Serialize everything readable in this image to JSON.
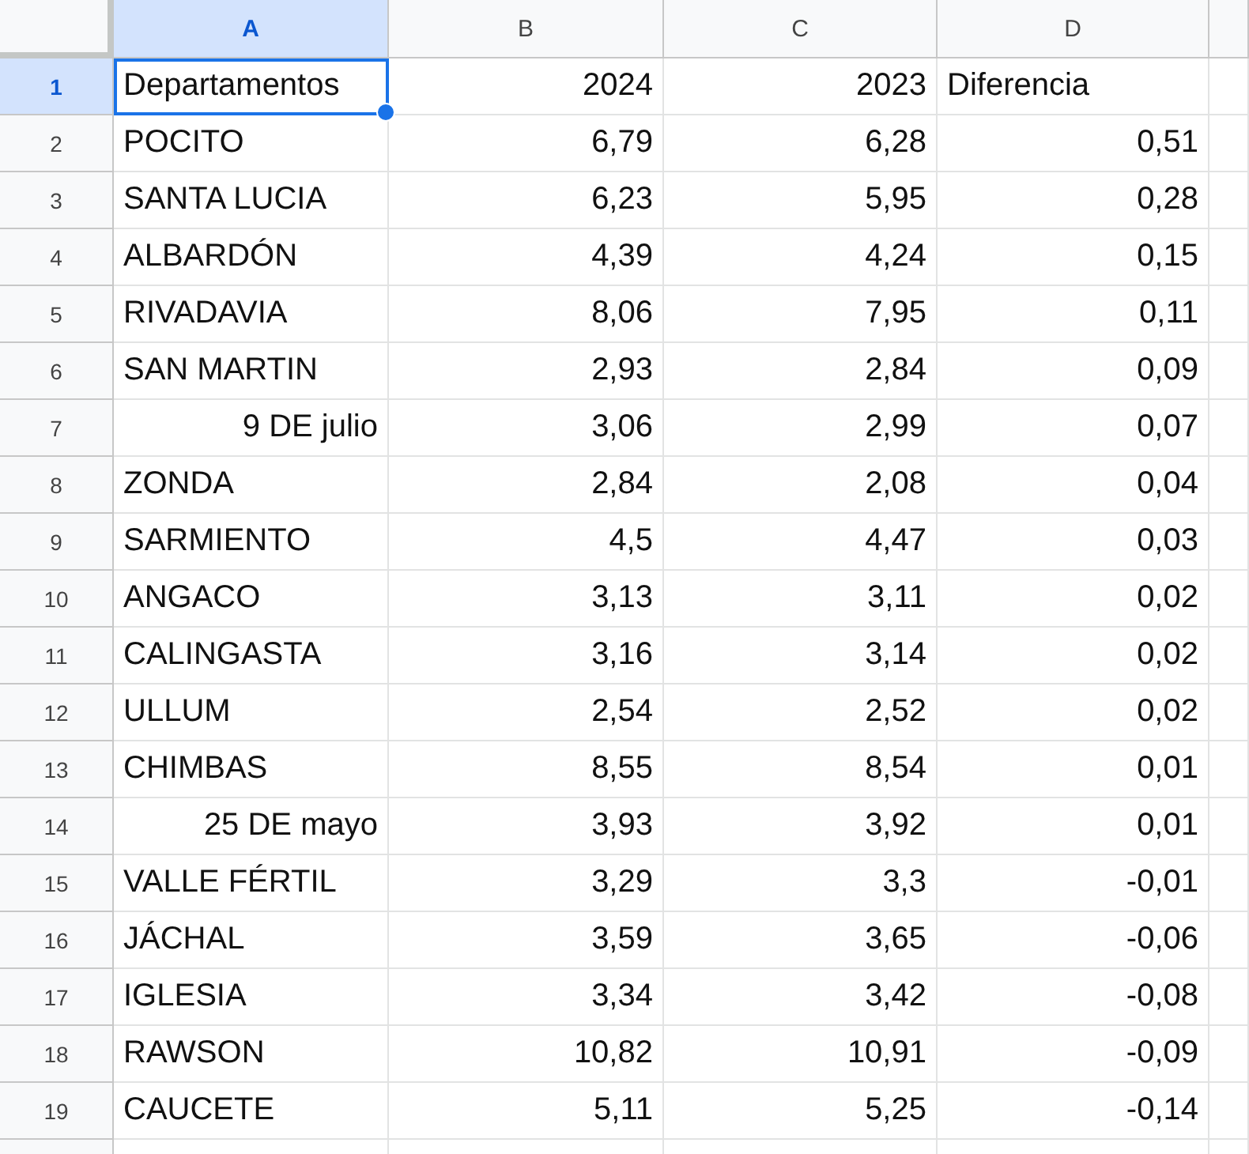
{
  "columns": [
    {
      "label": "A",
      "selected": true
    },
    {
      "label": "B",
      "selected": false
    },
    {
      "label": "C",
      "selected": false
    },
    {
      "label": "D",
      "selected": false
    }
  ],
  "rows": [
    {
      "number": "1",
      "selected": true,
      "cells": [
        {
          "text": "Departamentos",
          "right_aligned": false,
          "selected": true
        },
        {
          "text": "2024",
          "right_aligned": true,
          "selected": false
        },
        {
          "text": "2023",
          "right_aligned": true,
          "selected": false
        },
        {
          "text": "Diferencia",
          "right_aligned": false,
          "selected": false
        }
      ]
    },
    {
      "number": "2",
      "selected": false,
      "cells": [
        {
          "text": "POCITO",
          "right_aligned": false,
          "selected": false
        },
        {
          "text": "6,79",
          "right_aligned": true,
          "selected": false
        },
        {
          "text": "6,28",
          "right_aligned": true,
          "selected": false
        },
        {
          "text": "0,51",
          "right_aligned": true,
          "selected": false
        }
      ]
    },
    {
      "number": "3",
      "selected": false,
      "cells": [
        {
          "text": "SANTA LUCIA",
          "right_aligned": false,
          "selected": false
        },
        {
          "text": "6,23",
          "right_aligned": true,
          "selected": false
        },
        {
          "text": "5,95",
          "right_aligned": true,
          "selected": false
        },
        {
          "text": "0,28",
          "right_aligned": true,
          "selected": false
        }
      ]
    },
    {
      "number": "4",
      "selected": false,
      "cells": [
        {
          "text": "ALBARDÓN",
          "right_aligned": false,
          "selected": false
        },
        {
          "text": "4,39",
          "right_aligned": true,
          "selected": false
        },
        {
          "text": "4,24",
          "right_aligned": true,
          "selected": false
        },
        {
          "text": "0,15",
          "right_aligned": true,
          "selected": false
        }
      ]
    },
    {
      "number": "5",
      "selected": false,
      "cells": [
        {
          "text": "RIVADAVIA",
          "right_aligned": false,
          "selected": false
        },
        {
          "text": "8,06",
          "right_aligned": true,
          "selected": false
        },
        {
          "text": "7,95",
          "right_aligned": true,
          "selected": false
        },
        {
          "text": "0,11",
          "right_aligned": true,
          "selected": false
        }
      ]
    },
    {
      "number": "6",
      "selected": false,
      "cells": [
        {
          "text": "SAN MARTIN",
          "right_aligned": false,
          "selected": false
        },
        {
          "text": "2,93",
          "right_aligned": true,
          "selected": false
        },
        {
          "text": "2,84",
          "right_aligned": true,
          "selected": false
        },
        {
          "text": "0,09",
          "right_aligned": true,
          "selected": false
        }
      ]
    },
    {
      "number": "7",
      "selected": false,
      "cells": [
        {
          "text": "9 DE julio",
          "right_aligned": true,
          "selected": false
        },
        {
          "text": "3,06",
          "right_aligned": true,
          "selected": false
        },
        {
          "text": "2,99",
          "right_aligned": true,
          "selected": false
        },
        {
          "text": "0,07",
          "right_aligned": true,
          "selected": false
        }
      ]
    },
    {
      "number": "8",
      "selected": false,
      "cells": [
        {
          "text": "ZONDA",
          "right_aligned": false,
          "selected": false
        },
        {
          "text": "2,84",
          "right_aligned": true,
          "selected": false
        },
        {
          "text": "2,08",
          "right_aligned": true,
          "selected": false
        },
        {
          "text": "0,04",
          "right_aligned": true,
          "selected": false
        }
      ]
    },
    {
      "number": "9",
      "selected": false,
      "cells": [
        {
          "text": "SARMIENTO",
          "right_aligned": false,
          "selected": false
        },
        {
          "text": "4,5",
          "right_aligned": true,
          "selected": false
        },
        {
          "text": "4,47",
          "right_aligned": true,
          "selected": false
        },
        {
          "text": "0,03",
          "right_aligned": true,
          "selected": false
        }
      ]
    },
    {
      "number": "10",
      "selected": false,
      "cells": [
        {
          "text": "ANGACO",
          "right_aligned": false,
          "selected": false
        },
        {
          "text": "3,13",
          "right_aligned": true,
          "selected": false
        },
        {
          "text": "3,11",
          "right_aligned": true,
          "selected": false
        },
        {
          "text": "0,02",
          "right_aligned": true,
          "selected": false
        }
      ]
    },
    {
      "number": "11",
      "selected": false,
      "cells": [
        {
          "text": "CALINGASTA",
          "right_aligned": false,
          "selected": false
        },
        {
          "text": "3,16",
          "right_aligned": true,
          "selected": false
        },
        {
          "text": "3,14",
          "right_aligned": true,
          "selected": false
        },
        {
          "text": "0,02",
          "right_aligned": true,
          "selected": false
        }
      ]
    },
    {
      "number": "12",
      "selected": false,
      "cells": [
        {
          "text": "ULLUM",
          "right_aligned": false,
          "selected": false
        },
        {
          "text": "2,54",
          "right_aligned": true,
          "selected": false
        },
        {
          "text": "2,52",
          "right_aligned": true,
          "selected": false
        },
        {
          "text": "0,02",
          "right_aligned": true,
          "selected": false
        }
      ]
    },
    {
      "number": "13",
      "selected": false,
      "cells": [
        {
          "text": "CHIMBAS",
          "right_aligned": false,
          "selected": false
        },
        {
          "text": "8,55",
          "right_aligned": true,
          "selected": false
        },
        {
          "text": "8,54",
          "right_aligned": true,
          "selected": false
        },
        {
          "text": "0,01",
          "right_aligned": true,
          "selected": false
        }
      ]
    },
    {
      "number": "14",
      "selected": false,
      "cells": [
        {
          "text": "25 DE mayo",
          "right_aligned": true,
          "selected": false
        },
        {
          "text": "3,93",
          "right_aligned": true,
          "selected": false
        },
        {
          "text": "3,92",
          "right_aligned": true,
          "selected": false
        },
        {
          "text": "0,01",
          "right_aligned": true,
          "selected": false
        }
      ]
    },
    {
      "number": "15",
      "selected": false,
      "cells": [
        {
          "text": "VALLE FÉRTIL",
          "right_aligned": false,
          "selected": false
        },
        {
          "text": "3,29",
          "right_aligned": true,
          "selected": false
        },
        {
          "text": "3,3",
          "right_aligned": true,
          "selected": false
        },
        {
          "text": "-0,01",
          "right_aligned": true,
          "selected": false
        }
      ]
    },
    {
      "number": "16",
      "selected": false,
      "cells": [
        {
          "text": "JÁCHAL",
          "right_aligned": false,
          "selected": false
        },
        {
          "text": "3,59",
          "right_aligned": true,
          "selected": false
        },
        {
          "text": "3,65",
          "right_aligned": true,
          "selected": false
        },
        {
          "text": "-0,06",
          "right_aligned": true,
          "selected": false
        }
      ]
    },
    {
      "number": "17",
      "selected": false,
      "cells": [
        {
          "text": "IGLESIA",
          "right_aligned": false,
          "selected": false
        },
        {
          "text": "3,34",
          "right_aligned": true,
          "selected": false
        },
        {
          "text": "3,42",
          "right_aligned": true,
          "selected": false
        },
        {
          "text": "-0,08",
          "right_aligned": true,
          "selected": false
        }
      ]
    },
    {
      "number": "18",
      "selected": false,
      "cells": [
        {
          "text": "RAWSON",
          "right_aligned": false,
          "selected": false
        },
        {
          "text": "10,82",
          "right_aligned": true,
          "selected": false
        },
        {
          "text": "10,91",
          "right_aligned": true,
          "selected": false
        },
        {
          "text": "-0,09",
          "right_aligned": true,
          "selected": false
        }
      ]
    },
    {
      "number": "19",
      "selected": false,
      "cells": [
        {
          "text": "CAUCETE",
          "right_aligned": false,
          "selected": false
        },
        {
          "text": "5,11",
          "right_aligned": true,
          "selected": false
        },
        {
          "text": "5,25",
          "right_aligned": true,
          "selected": false
        },
        {
          "text": "-0,14",
          "right_aligned": true,
          "selected": false
        }
      ]
    }
  ]
}
